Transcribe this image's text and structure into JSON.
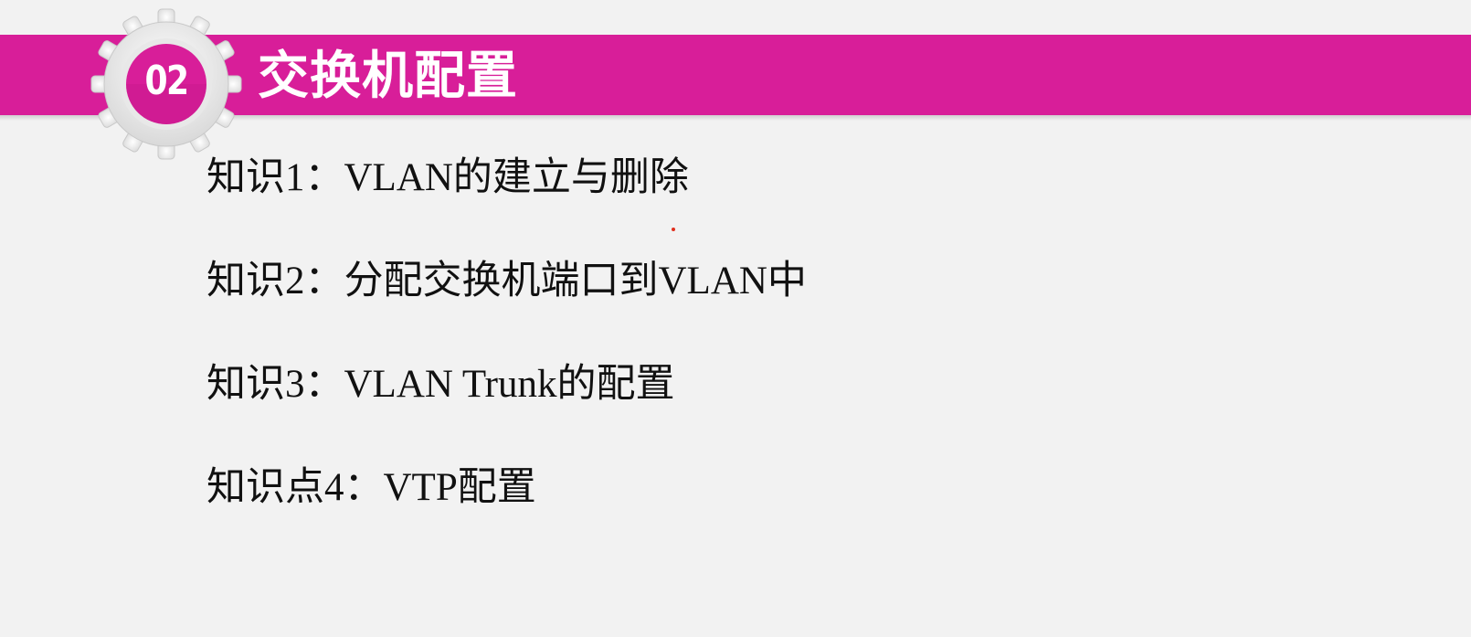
{
  "header": {
    "number": "02",
    "title": "交换机配置",
    "accent_color": "#d81e99",
    "badge_icon": "gear-icon"
  },
  "topics": [
    "知识1：VLAN的建立与删除",
    "知识2：分配交换机端口到VLAN中",
    "知识3：VLAN Trunk的配置",
    "知识点4：VTP配置"
  ]
}
